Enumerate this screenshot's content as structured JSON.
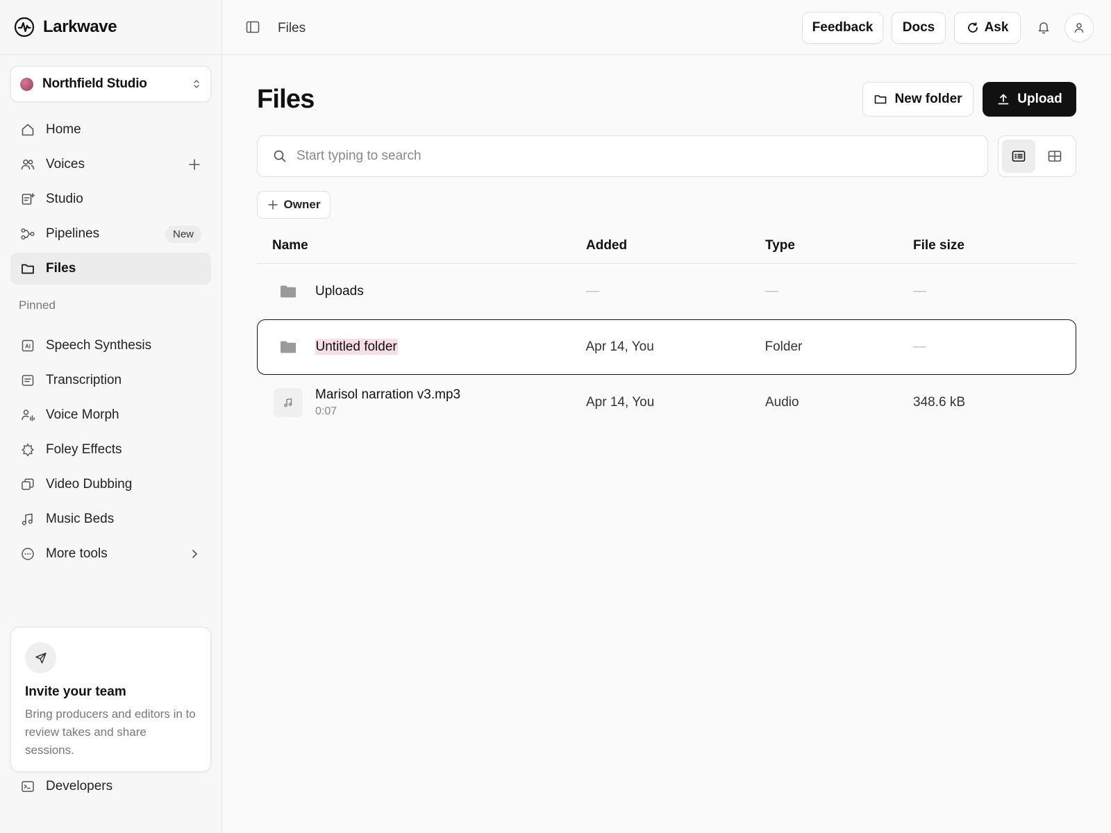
{
  "app": {
    "name": "Larkwave"
  },
  "workspace": {
    "name": "Northfield Studio"
  },
  "nav": [
    {
      "label": "Home",
      "icon": "home-icon"
    },
    {
      "label": "Voices",
      "icon": "users-icon"
    },
    {
      "label": "Studio",
      "icon": "studio-icon"
    },
    {
      "label": "Pipelines",
      "icon": "pipeline-icon",
      "badge": "New"
    },
    {
      "label": "Files",
      "icon": "folder-icon",
      "active": true
    }
  ],
  "pinned": {
    "label": "Pinned",
    "items": [
      {
        "label": "Speech Synthesis",
        "icon": "ai-icon"
      },
      {
        "label": "Transcription",
        "icon": "transcript-icon"
      },
      {
        "label": "Voice Morph",
        "icon": "voice-morph-icon"
      },
      {
        "label": "Foley Effects",
        "icon": "sparkle-icon"
      },
      {
        "label": "Video Dubbing",
        "icon": "dubbing-icon"
      },
      {
        "label": "Music Beds",
        "icon": "music-icon"
      },
      {
        "label": "More tools",
        "icon": "more-icon"
      }
    ]
  },
  "invite": {
    "title": "Invite your team",
    "text": "Bring producers and editors in to review takes and share sessions."
  },
  "developers": {
    "label": "Developers"
  },
  "topbar": {
    "breadcrumb": "Files",
    "feedback": "Feedback",
    "docs": "Docs",
    "ask": "Ask"
  },
  "main": {
    "title": "Files",
    "new_folder": "New folder",
    "upload": "Upload",
    "search_placeholder": "Start typing to search",
    "owner_filter": "Owner"
  },
  "table": {
    "columns": {
      "name": "Name",
      "added": "Added",
      "type": "Type",
      "size": "File size"
    },
    "rows": [
      {
        "name": "Uploads",
        "added": "—",
        "type": "—",
        "size": "—",
        "kind": "folder"
      },
      {
        "name": "Untitled folder",
        "added": "Apr 14, You",
        "type": "Folder",
        "size": "—",
        "kind": "folder",
        "selected": true
      },
      {
        "name": "Marisol narration v3.mp3",
        "duration": "0:07",
        "added": "Apr 14, You",
        "type": "Audio",
        "size": "348.6 kB",
        "kind": "audio"
      }
    ]
  },
  "colors": {
    "accent": "#111111",
    "highlight": "#f6dde6",
    "workspace_dot": "#b24e72"
  }
}
